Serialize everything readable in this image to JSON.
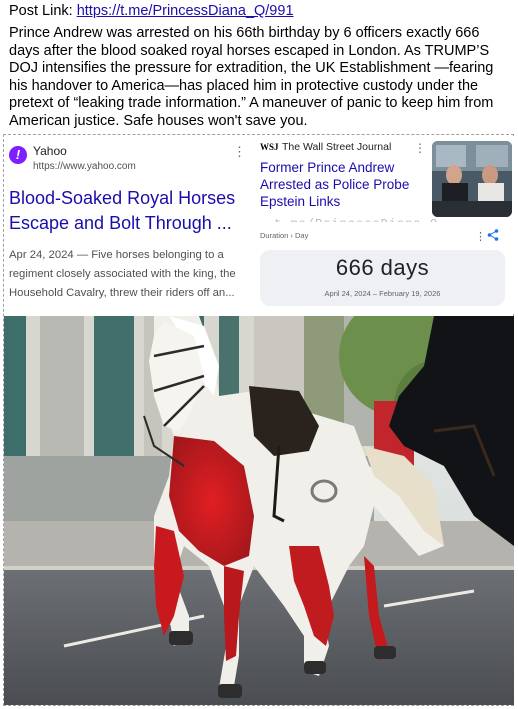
{
  "post": {
    "link_label": "Post Link:",
    "link_url": "https://t.me/PrincessDiana_Q/991",
    "text": "Prince Andrew was arrested on his 66th birthday by 6 officers exactly 666 days after the blood soaked royal horses escaped in London. As TRUMP’S DOJ intensifies the pressure for extradition, the UK Establishment —fearing his handover to America—has placed him in protective custody under the pretext of “leaking trade information.” A maneuver of panic to keep him from American justice. Safe houses won't save you."
  },
  "yahoo_card": {
    "source_name": "Yahoo",
    "source_url": "https://www.yahoo.com",
    "title": "Blood-Soaked Royal Horses Escape and Bolt Through ...",
    "snippet": "Apr 24, 2024 — Five horses belonging to a regiment closely associated with the king, the Household Cavalry, threw their riders off an...",
    "logo_icon": "yahoo-logo-icon",
    "menu_icon": "more-vert-icon"
  },
  "wsj_card": {
    "logo": "WSJ",
    "source_name": "The Wall Street Journal",
    "title": "Former Prince Andrew Arrested as Police Probe Epstein Links",
    "menu_icon": "more-vert-icon"
  },
  "watermark": "t.me/PrincessDiana_Q",
  "duration_card": {
    "label": "Duration › Day",
    "value": "666 days",
    "range": "April 24, 2024 – February 19, 2026",
    "share_icon": "share-icon",
    "menu_icon": "more-vert-icon"
  },
  "colors": {
    "link": "#1a0dab",
    "yahoo_purple": "#7e1fff",
    "blood": "#d01c1f"
  }
}
